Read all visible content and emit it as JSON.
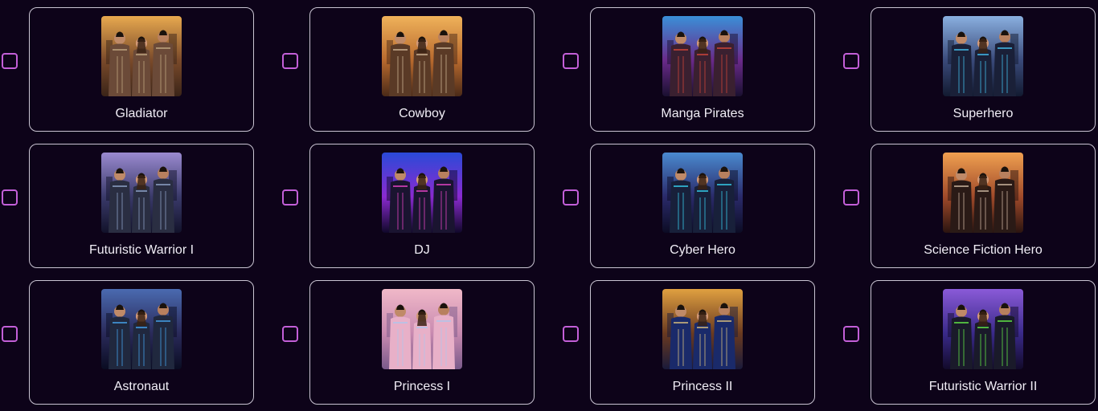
{
  "styles": [
    {
      "label": "Gladiator",
      "selected": false,
      "palette": [
        "#e8a94f",
        "#7a4a2a",
        "#3a2418"
      ],
      "figure_color": "#6b4a38",
      "accent": "#c9b08a"
    },
    {
      "label": "Cowboy",
      "selected": false,
      "palette": [
        "#f0b25a",
        "#b86a2e",
        "#4a2a18"
      ],
      "figure_color": "#5a3a26",
      "accent": "#d8c0a0"
    },
    {
      "label": "Manga Pirates",
      "selected": false,
      "palette": [
        "#3a8fd8",
        "#6a2a8a",
        "#1a1030"
      ],
      "figure_color": "#3a2030",
      "accent": "#e04a3a"
    },
    {
      "label": "Superhero",
      "selected": false,
      "palette": [
        "#8ab0e0",
        "#3a4a7a",
        "#121a30"
      ],
      "figure_color": "#1a2038",
      "accent": "#4ad0ff"
    },
    {
      "label": "Futuristic Warrior I",
      "selected": false,
      "palette": [
        "#9a8ad0",
        "#3a3a6a",
        "#12122a"
      ],
      "figure_color": "#2a2e42",
      "accent": "#9ab0d8"
    },
    {
      "label": "DJ",
      "selected": false,
      "palette": [
        "#2a4ad8",
        "#8a2ad0",
        "#10082a"
      ],
      "figure_color": "#1a1430",
      "accent": "#ff4ad8"
    },
    {
      "label": "Cyber Hero",
      "selected": false,
      "palette": [
        "#4a8ad0",
        "#2a2a6a",
        "#0c0c24"
      ],
      "figure_color": "#18203a",
      "accent": "#3ae0ff"
    },
    {
      "label": "Science Fiction Hero",
      "selected": false,
      "palette": [
        "#f0a050",
        "#a04a2a",
        "#2a1410"
      ],
      "figure_color": "#2a1a16",
      "accent": "#e0c8b0"
    },
    {
      "label": "Astronaut",
      "selected": false,
      "palette": [
        "#4a6ab0",
        "#2a2a5a",
        "#0a0c22"
      ],
      "figure_color": "#20283e",
      "accent": "#4ab0ff"
    },
    {
      "label": "Princess I",
      "selected": false,
      "palette": [
        "#f0b8c8",
        "#c88ab0",
        "#7a5a8a"
      ],
      "figure_color": "#e8b0c8",
      "accent": "#a8c8f0"
    },
    {
      "label": "Princess II",
      "selected": false,
      "palette": [
        "#e0a040",
        "#6a3a20",
        "#1a1a3a"
      ],
      "figure_color": "#1a2a6a",
      "accent": "#f0d080"
    },
    {
      "label": "Futuristic Warrior II",
      "selected": false,
      "palette": [
        "#8a5ad8",
        "#3a2a8a",
        "#120a2a"
      ],
      "figure_color": "#1a1a2a",
      "accent": "#6aff4a"
    }
  ]
}
